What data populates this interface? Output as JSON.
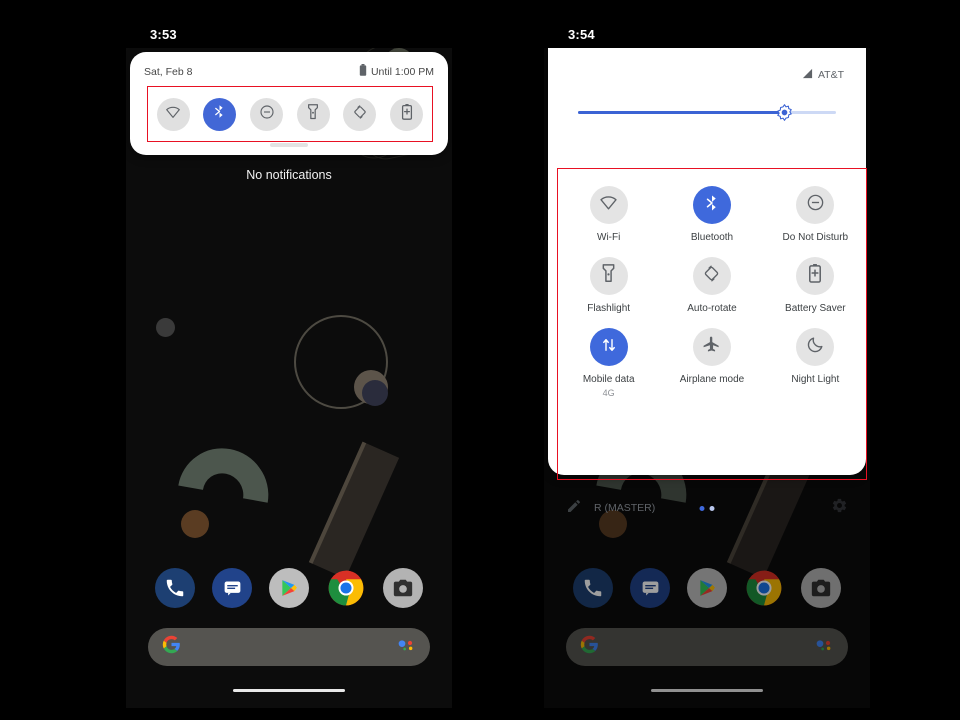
{
  "left_phone": {
    "status_clock": "3:53",
    "shade": {
      "date": "Sat, Feb 8",
      "battery_status": "Until 1:00 PM",
      "battery_icon": "battery-icon",
      "drag_handle": "drag-handle",
      "compact_tiles": [
        {
          "name": "wifi",
          "icon": "wifi-icon",
          "active": false
        },
        {
          "name": "bluetooth",
          "icon": "bluetooth-icon",
          "active": true
        },
        {
          "name": "dnd",
          "icon": "do-not-disturb-icon",
          "active": false
        },
        {
          "name": "flashlight",
          "icon": "flashlight-icon",
          "active": false
        },
        {
          "name": "autorotate",
          "icon": "auto-rotate-icon",
          "active": false
        },
        {
          "name": "battery",
          "icon": "battery-saver-icon",
          "active": false
        }
      ]
    },
    "home": {
      "no_notifications": "No notifications",
      "dock": [
        {
          "name": "phone",
          "icon": "phone-icon"
        },
        {
          "name": "messages",
          "icon": "messages-icon"
        },
        {
          "name": "play",
          "icon": "play-store-icon"
        },
        {
          "name": "chrome",
          "icon": "chrome-icon"
        },
        {
          "name": "camera",
          "icon": "camera-icon"
        }
      ],
      "search": {
        "icon": "google-g-icon",
        "assistant_icon": "assistant-icon",
        "value": "",
        "placeholder": ""
      },
      "nav_pill": "home-gesture-pill"
    }
  },
  "right_phone": {
    "status_clock": "3:54",
    "shade": {
      "carrier": "AT&T",
      "signal_icon": "signal-icon",
      "brightness": {
        "icon": "brightness-icon",
        "value": 80
      },
      "tiles": [
        {
          "label": "Wi-Fi",
          "sub": "",
          "icon": "wifi-icon",
          "active": false
        },
        {
          "label": "Bluetooth",
          "sub": "",
          "icon": "bluetooth-icon",
          "active": true
        },
        {
          "label": "Do Not Disturb",
          "sub": "",
          "icon": "do-not-disturb-icon",
          "active": false
        },
        {
          "label": "Flashlight",
          "sub": "",
          "icon": "flashlight-icon",
          "active": false
        },
        {
          "label": "Auto-rotate",
          "sub": "",
          "icon": "auto-rotate-icon",
          "active": false
        },
        {
          "label": "Battery Saver",
          "sub": "",
          "icon": "battery-saver-icon",
          "active": false
        },
        {
          "label": "Mobile data",
          "sub": "4G",
          "icon": "mobile-data-icon",
          "active": true
        },
        {
          "label": "Airplane mode",
          "sub": "",
          "icon": "airplane-icon",
          "active": false
        },
        {
          "label": "Night Light",
          "sub": "",
          "icon": "night-light-icon",
          "active": false
        }
      ],
      "footer": {
        "edit_icon": "pencil-icon",
        "user": "R (MASTER)",
        "pages": [
          {
            "active": true
          },
          {
            "active": false
          }
        ],
        "settings_icon": "gear-icon"
      }
    },
    "home": {
      "dock": [
        {
          "name": "phone",
          "icon": "phone-icon"
        },
        {
          "name": "messages",
          "icon": "messages-icon"
        },
        {
          "name": "play",
          "icon": "play-store-icon"
        },
        {
          "name": "chrome",
          "icon": "chrome-icon"
        },
        {
          "name": "camera",
          "icon": "camera-icon"
        }
      ],
      "search": {
        "icon": "google-g-icon",
        "assistant_icon": "assistant-icon",
        "value": "",
        "placeholder": ""
      },
      "nav_pill": "home-gesture-pill"
    }
  },
  "annotation": {
    "color": "#e81123"
  }
}
